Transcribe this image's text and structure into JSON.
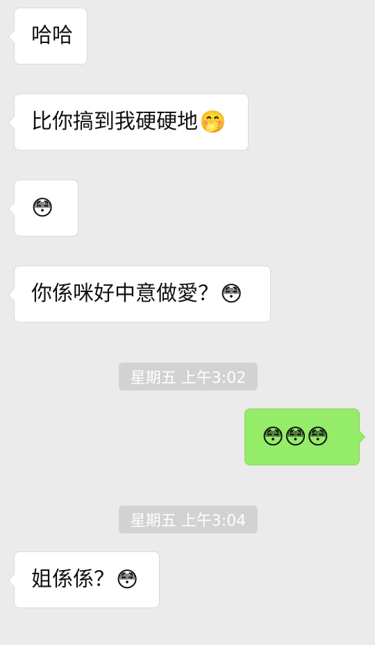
{
  "messages": [
    {
      "text": "哈哈",
      "emoji": ""
    },
    {
      "text": "比你搞到我硬硬地",
      "emoji": "🤭"
    },
    {
      "text": "",
      "emoji": "😳"
    },
    {
      "text": "你係咪好中意做愛？",
      "emoji": "😳"
    },
    {
      "text": "",
      "emoji": "😳😳😳"
    },
    {
      "text": "姐係係？",
      "emoji": "😳"
    }
  ],
  "timestamps": [
    "星期五 上午3:02",
    "星期五 上午3:04"
  ],
  "colors": {
    "background": "#ebebeb",
    "incoming_bubble": "#ffffff",
    "outgoing_bubble": "#95ec69",
    "timestamp_bg": "#d2d2d2"
  }
}
